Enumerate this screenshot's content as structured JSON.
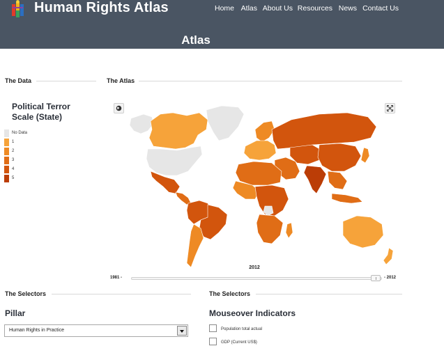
{
  "site": {
    "title": "Human Rights Atlas",
    "logo_icon": "colorful-figure-logo-icon"
  },
  "nav": {
    "items": [
      "Home",
      "Atlas",
      "About Us",
      "Resources",
      "News",
      "Contact Us"
    ]
  },
  "page": {
    "title": "Atlas"
  },
  "sections": {
    "data_label": "The Data",
    "atlas_label": "The Atlas",
    "selectors_left_label": "The Selectors",
    "selectors_right_label": "The Selectors"
  },
  "legend": {
    "title": "Political Terror Scale (State)",
    "items": [
      {
        "label": "No Data",
        "color": "#e6e6e6"
      },
      {
        "label": "1",
        "color": "#f6a33a"
      },
      {
        "label": "2",
        "color": "#ee8a24"
      },
      {
        "label": "3",
        "color": "#e06d16"
      },
      {
        "label": "4",
        "color": "#d2550d"
      },
      {
        "label": "5",
        "color": "#bb3d06"
      }
    ]
  },
  "map": {
    "globe_button_icon": "globe-icon",
    "fullscreen_button_icon": "fullscreen-icon",
    "regions": [
      {
        "name": "greenland",
        "level": "No Data"
      },
      {
        "name": "alaska",
        "level": "No Data"
      },
      {
        "name": "canada",
        "level": "1"
      },
      {
        "name": "united-states",
        "level": "No Data"
      },
      {
        "name": "mexico",
        "level": "4"
      },
      {
        "name": "central-america",
        "level": "3"
      },
      {
        "name": "south-america-north",
        "level": "4"
      },
      {
        "name": "brazil",
        "level": "4"
      },
      {
        "name": "south-america-south",
        "level": "2"
      },
      {
        "name": "europe-west",
        "level": "1"
      },
      {
        "name": "scandinavia",
        "level": "2"
      },
      {
        "name": "russia",
        "level": "4"
      },
      {
        "name": "middle-east",
        "level": "3"
      },
      {
        "name": "central-asia",
        "level": "4"
      },
      {
        "name": "china",
        "level": "4"
      },
      {
        "name": "india",
        "level": "5"
      },
      {
        "name": "southeast-asia",
        "level": "3"
      },
      {
        "name": "japan",
        "level": "2"
      },
      {
        "name": "north-africa",
        "level": "3"
      },
      {
        "name": "west-africa",
        "level": "2"
      },
      {
        "name": "central-africa",
        "level": "4"
      },
      {
        "name": "no-data-africa",
        "level": "No Data"
      },
      {
        "name": "southern-africa",
        "level": "3"
      },
      {
        "name": "madagascar",
        "level": "2"
      },
      {
        "name": "indonesia",
        "level": "3"
      },
      {
        "name": "australia",
        "level": "1"
      },
      {
        "name": "new-zealand",
        "level": "1"
      }
    ]
  },
  "timeline": {
    "current_year": "2012",
    "start_label": "1981 -",
    "end_label": "- 2012",
    "position": 1.0
  },
  "pillar": {
    "heading": "Pillar",
    "selected": "Human Rights in Practice"
  },
  "mouseover": {
    "heading": "Mouseover Indicators",
    "items": [
      {
        "label": "Population total actual",
        "checked": false
      },
      {
        "label": "GDP (Current US$)",
        "checked": false
      }
    ]
  }
}
